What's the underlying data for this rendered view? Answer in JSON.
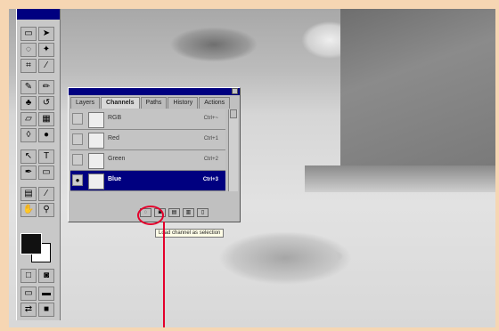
{
  "palette": {
    "tabs": [
      "Layers",
      "Channels",
      "Paths",
      "History",
      "Actions"
    ],
    "channels": [
      {
        "name": "RGB",
        "shortcut": "Ctrl+~",
        "visible": false,
        "selected": false
      },
      {
        "name": "Red",
        "shortcut": "Ctrl+1",
        "visible": false,
        "selected": false
      },
      {
        "name": "Green",
        "shortcut": "Ctrl+2",
        "visible": false,
        "selected": false
      },
      {
        "name": "Blue",
        "shortcut": "Ctrl+3",
        "visible": true,
        "selected": true
      }
    ],
    "tooltip": "Load channel as selection"
  },
  "colors": {
    "highlight": "#e4002b",
    "titlebar": "#000080",
    "frame": "#f6d6b3"
  }
}
